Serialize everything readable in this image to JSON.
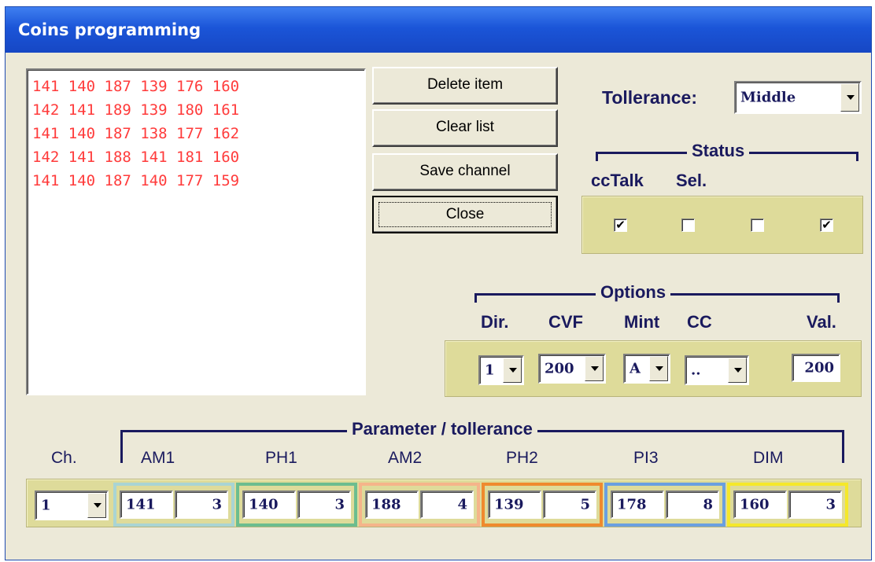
{
  "window": {
    "title": "Coins programming"
  },
  "list": {
    "rows": [
      "141 140 187 139 176 160",
      "142 141 189 139 180 161",
      "141 140 187 138 177 162",
      "142 141 188 141 181 160",
      "141 140 187 140 177 159"
    ]
  },
  "buttons": {
    "delete": "Delete item",
    "clear": "Clear list",
    "save": "Save channel",
    "close": "Close"
  },
  "tolerance": {
    "label": "Tollerance:",
    "value": "Middle"
  },
  "status": {
    "title": "Status",
    "label_cctalk": "ccTalk",
    "label_sel": "Sel.",
    "checkboxes": [
      true,
      false,
      false,
      true
    ]
  },
  "options": {
    "title": "Options",
    "labels": {
      "dir": "Dir.",
      "cvf": "CVF",
      "mint": "Mint",
      "cc": "CC",
      "val": "Val."
    },
    "dir": "1",
    "cvf": "200",
    "mint": "A",
    "cc": "..",
    "val": "200"
  },
  "params": {
    "title": "Parameter / tollerance",
    "ch_label": "Ch.",
    "ch_value": "1",
    "groups": [
      {
        "name": "AM1",
        "value": "141",
        "tol": "3",
        "color": "#a9d4d4"
      },
      {
        "name": "PH1",
        "value": "140",
        "tol": "3",
        "color": "#6cbd8f"
      },
      {
        "name": "AM2",
        "value": "188",
        "tol": "4",
        "color": "#f5b48a"
      },
      {
        "name": "PH2",
        "value": "139",
        "tol": "5",
        "color": "#ef8a2e"
      },
      {
        "name": "PI3",
        "value": "178",
        "tol": "8",
        "color": "#6a9fe0"
      },
      {
        "name": "DIM",
        "value": "160",
        "tol": "3",
        "color": "#f5e82a"
      }
    ]
  },
  "colors": {
    "title_bar": "#1b55d8",
    "list_text": "#ff3b3b",
    "label_text": "#1a1a5e",
    "panel": "#dedb9a"
  }
}
